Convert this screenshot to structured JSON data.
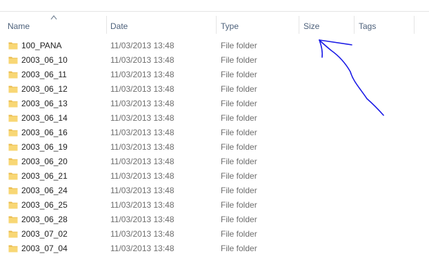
{
  "header": {
    "columns": {
      "name": "Name",
      "date": "Date",
      "type": "Type",
      "size": "Size",
      "tags": "Tags"
    }
  },
  "colors": {
    "header_text": "#4c607a",
    "folder": "#f8d775",
    "annotation_ink": "#1a1ae6"
  },
  "rows": [
    {
      "name": "100_PANA",
      "date": "11/03/2013 13:48",
      "type": "File folder"
    },
    {
      "name": "2003_06_10",
      "date": "11/03/2013 13:48",
      "type": "File folder"
    },
    {
      "name": "2003_06_11",
      "date": "11/03/2013 13:48",
      "type": "File folder"
    },
    {
      "name": "2003_06_12",
      "date": "11/03/2013 13:48",
      "type": "File folder"
    },
    {
      "name": "2003_06_13",
      "date": "11/03/2013 13:48",
      "type": "File folder"
    },
    {
      "name": "2003_06_14",
      "date": "11/03/2013 13:48",
      "type": "File folder"
    },
    {
      "name": "2003_06_16",
      "date": "11/03/2013 13:48",
      "type": "File folder"
    },
    {
      "name": "2003_06_19",
      "date": "11/03/2013 13:48",
      "type": "File folder"
    },
    {
      "name": "2003_06_20",
      "date": "11/03/2013 13:48",
      "type": "File folder"
    },
    {
      "name": "2003_06_21",
      "date": "11/03/2013 13:48",
      "type": "File folder"
    },
    {
      "name": "2003_06_24",
      "date": "11/03/2013 13:48",
      "type": "File folder"
    },
    {
      "name": "2003_06_25",
      "date": "11/03/2013 13:48",
      "type": "File folder"
    },
    {
      "name": "2003_06_28",
      "date": "11/03/2013 13:48",
      "type": "File folder"
    },
    {
      "name": "2003_07_02",
      "date": "11/03/2013 13:48",
      "type": "File folder"
    },
    {
      "name": "2003_07_04",
      "date": "11/03/2013 13:48",
      "type": "File folder"
    }
  ]
}
